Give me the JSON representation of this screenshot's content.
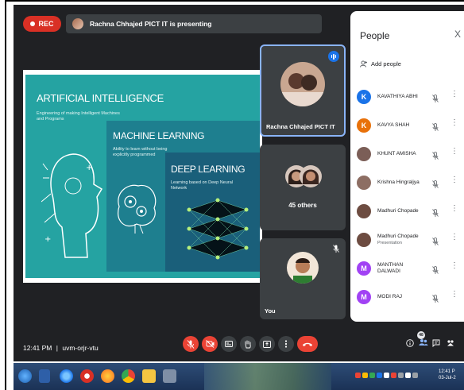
{
  "recording": {
    "label": "REC"
  },
  "presenting": {
    "text": "Rachna Chhajed PICT IT is presenting"
  },
  "slide": {
    "ai_title": "ARTIFICIAL INTELLIGENCE",
    "ai_sub": "Engineering of making Intelligent Machines and Programs",
    "ml_title": "MACHINE LEARNING",
    "ml_sub": "Ability to learn without being explicitly programmed",
    "dl_title": "DEEP LEARNING",
    "dl_sub": "Learning based on Deep Neural Network"
  },
  "tiles": [
    {
      "name": "Rachna Chhajed PICT IT"
    },
    {
      "name": "45 others"
    },
    {
      "name": "You"
    }
  ],
  "people_panel": {
    "title": "People",
    "close": "X",
    "add_people": "Add people",
    "participants": [
      {
        "initial": "K",
        "name": "KAVATHIYA ABHI",
        "color": "#1a73e8",
        "sub": ""
      },
      {
        "initial": "K",
        "name": "KAVYA SHAH",
        "color": "#e8710a",
        "sub": ""
      },
      {
        "initial": "",
        "name": "KHUNT AMISHA",
        "color": "#7b5e57",
        "sub": ""
      },
      {
        "initial": "",
        "name": "Krishna Hingraljya",
        "color": "#8d6e63",
        "sub": ""
      },
      {
        "initial": "",
        "name": "Madhuri Chopade",
        "color": "#6d4c41",
        "sub": ""
      },
      {
        "initial": "",
        "name": "Madhuri Chopade",
        "color": "#6d4c41",
        "sub": "Presentation"
      },
      {
        "initial": "M",
        "name": "MANTHAN DALWADI",
        "color": "#a142f4",
        "sub": ""
      },
      {
        "initial": "M",
        "name": "MODI RAJ",
        "color": "#a142f4",
        "sub": ""
      }
    ]
  },
  "bottom_bar": {
    "time": "12:41 PM",
    "separator": "|",
    "meeting_code": "uvm-orjr-vtu",
    "people_count": "48"
  },
  "taskbar": {
    "clock_time": "12:41 P",
    "clock_date": "03-Jul-2"
  },
  "colors": {
    "meet_bg": "#202124",
    "tile_bg": "#3c4043",
    "red": "#ea4335",
    "accent_blue": "#8ab4f8",
    "slide_teal": "#25a3a2"
  }
}
